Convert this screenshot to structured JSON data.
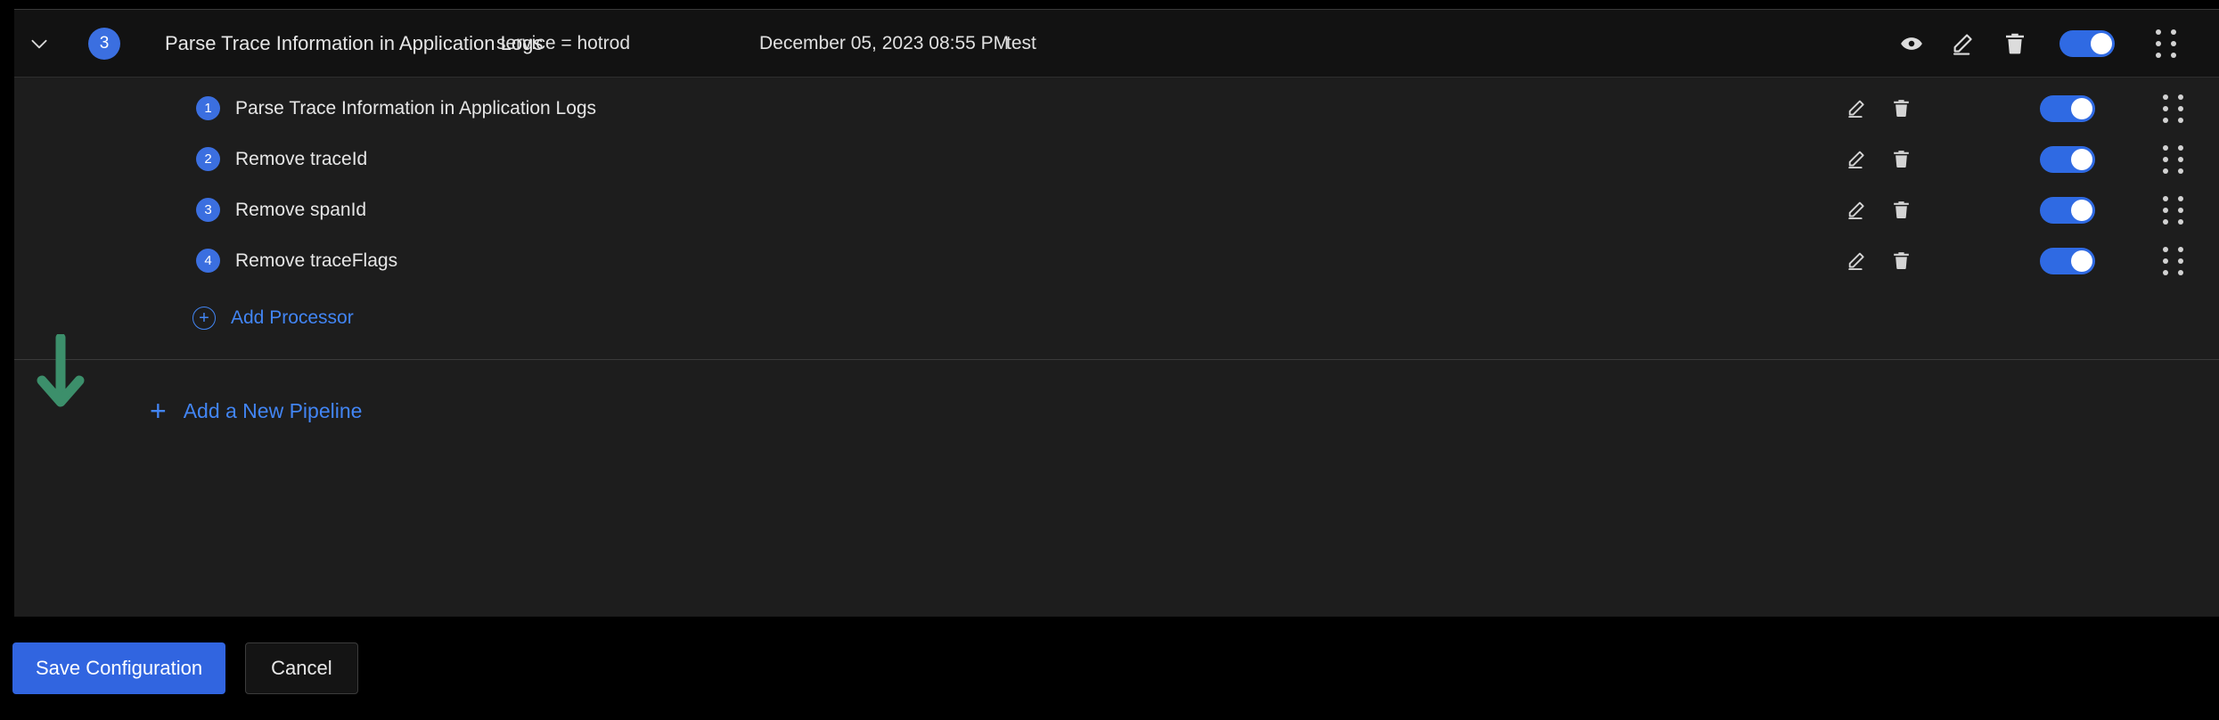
{
  "pipeline": {
    "expand_icon": "chevron-down-icon",
    "order_badge": "3",
    "name": "Parse Trace Information in Application Logs",
    "filter": "service = hotrod",
    "last_edited": "December 05, 2023 08:55 PM",
    "edited_by": "test",
    "actions": {
      "view_icon": "eye-icon",
      "edit_icon": "pencil-icon",
      "delete_icon": "trash-icon",
      "toggle_state": "on",
      "drag_icon": "drag-handle-icon"
    }
  },
  "processors": [
    {
      "order": "1",
      "name": "Parse Trace Information in Application Logs",
      "edit_icon": "pencil-icon",
      "delete_icon": "trash-icon",
      "toggle_state": "on",
      "drag_icon": "drag-handle-icon"
    },
    {
      "order": "2",
      "name": "Remove traceId",
      "edit_icon": "pencil-icon",
      "delete_icon": "trash-icon",
      "toggle_state": "on",
      "drag_icon": "drag-handle-icon"
    },
    {
      "order": "3",
      "name": "Remove spanId",
      "edit_icon": "pencil-icon",
      "delete_icon": "trash-icon",
      "toggle_state": "on",
      "drag_icon": "drag-handle-icon"
    },
    {
      "order": "4",
      "name": "Remove traceFlags",
      "edit_icon": "pencil-icon",
      "delete_icon": "trash-icon",
      "toggle_state": "on",
      "drag_icon": "drag-handle-icon"
    }
  ],
  "add_processor": {
    "icon": "plus-circle-icon",
    "label": "Add Processor"
  },
  "add_pipeline": {
    "icon": "plus-icon",
    "label": "Add a New Pipeline"
  },
  "footer": {
    "save_label": "Save Configuration",
    "cancel_label": "Cancel"
  },
  "annotation": {
    "arrow": "down-arrow-annotation",
    "color": "#3c8f6b"
  },
  "colors": {
    "accent_blue": "#3b6fe0",
    "link_blue": "#4285f4",
    "panel_bg": "#1d1d1d",
    "header_bg": "#121212",
    "page_bg": "#000000",
    "save_button": "#3165e0"
  }
}
